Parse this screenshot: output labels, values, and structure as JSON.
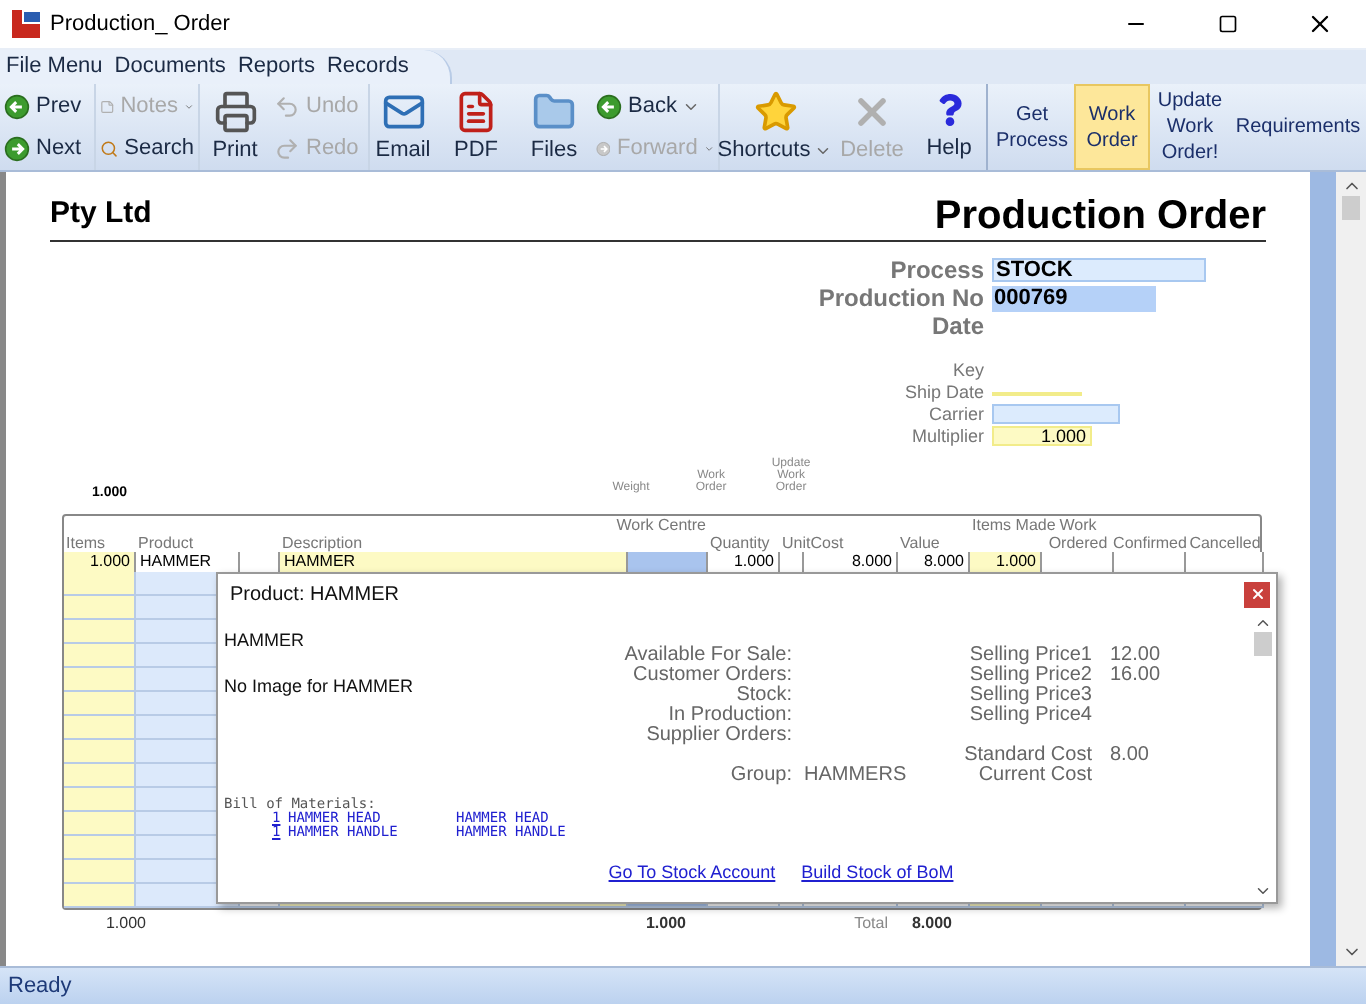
{
  "window": {
    "title": "Production_ Order"
  },
  "menu": [
    "File Menu",
    "Documents",
    "Reports",
    "Records"
  ],
  "toolbar": [
    {
      "kind": "pair",
      "top": {
        "label": "Prev",
        "disabled": false,
        "dropdown": false
      },
      "bottom": {
        "label": "Next",
        "disabled": false,
        "dropdown": false
      }
    },
    {
      "kind": "pair",
      "top": {
        "label": "Notes",
        "disabled": true,
        "dropdown": true
      },
      "bottom": {
        "label": "Search",
        "disabled": false,
        "dropdown": false
      }
    },
    {
      "kind": "large",
      "label": "Print",
      "disabled": false,
      "dropdown": false
    },
    {
      "kind": "pair",
      "top": {
        "label": "Undo",
        "disabled": true,
        "dropdown": false
      },
      "bottom": {
        "label": "Redo",
        "disabled": true,
        "dropdown": false
      }
    },
    {
      "kind": "large",
      "label": "Email",
      "disabled": false,
      "dropdown": false
    },
    {
      "kind": "large",
      "label": "PDF",
      "disabled": false,
      "dropdown": false
    },
    {
      "kind": "large",
      "label": "Files",
      "disabled": false,
      "dropdown": false
    },
    {
      "kind": "pair",
      "top": {
        "label": "Back",
        "disabled": false,
        "dropdown": true
      },
      "bottom": {
        "label": "Forward",
        "disabled": true,
        "dropdown": true
      }
    },
    {
      "kind": "large",
      "label": "Shortcuts",
      "disabled": false,
      "dropdown": true
    },
    {
      "kind": "large",
      "label": "Delete",
      "disabled": true,
      "dropdown": false
    },
    {
      "kind": "large",
      "label": "Help",
      "disabled": false,
      "dropdown": false
    },
    {
      "kind": "separator"
    },
    {
      "kind": "text",
      "label": "Get Process",
      "selected": false
    },
    {
      "kind": "text",
      "label": "Work Order",
      "selected": true
    },
    {
      "kind": "text",
      "label": "Update Work Order!",
      "selected": false
    },
    {
      "kind": "text",
      "label": "Requirements",
      "selected": false
    }
  ],
  "document": {
    "company": "Pty Ltd",
    "title": "Production Order",
    "fields": [
      {
        "label": "Process",
        "value": "STOCK",
        "kind": "lookup"
      },
      {
        "label": "Production No",
        "value": "000769",
        "kind": "highlighted"
      },
      {
        "label": "Date",
        "kind": "plain"
      },
      {
        "label": "Key",
        "kind": "small"
      },
      {
        "label": "Ship Date",
        "kind": "underline"
      },
      {
        "label": "Carrier",
        "kind": "small_lookup"
      },
      {
        "label": "Multiplier",
        "value": "1.000",
        "kind": "number"
      }
    ],
    "header_total": "1.000",
    "small_labels": [
      "Weight",
      "Work Order",
      "Update Work Order"
    ],
    "table": {
      "columns": [
        {
          "label": "Items",
          "kind": "column"
        },
        {
          "label": "Product",
          "kind": "column"
        },
        {
          "kind": "spacer"
        },
        {
          "label": "Description",
          "kind": "column"
        },
        {
          "label": "Work Centre",
          "kind": "column"
        },
        {
          "label": "Quantity",
          "kind": "column"
        },
        {
          "label": "UnitCost",
          "kind": "wide"
        },
        {
          "label": "Value",
          "kind": "column"
        },
        {
          "label": "Items Made",
          "kind": "column"
        },
        {
          "label": "Work Ordered",
          "kind": "column"
        },
        {
          "label": "Confirmed",
          "kind": "column"
        },
        {
          "label": "Cancelled",
          "kind": "column"
        }
      ],
      "rows": [
        {
          "items": "1.000",
          "product": "HAMMER",
          "description": "HAMMER",
          "quantity": "1.000",
          "unit_cost": "8.000",
          "value": "8.000",
          "items_made": "1.000"
        }
      ],
      "totals": {
        "items": "1.000",
        "work_centre": "1.000",
        "total_label": "Total",
        "value": "8.000"
      }
    }
  },
  "popup": {
    "title": "Product: HAMMER",
    "name": "HAMMER",
    "image_note": "No Image for HAMMER",
    "stats": [
      "Available For Sale:",
      "Customer Orders:",
      "Stock:",
      "In Production:",
      "Supplier Orders:"
    ],
    "group": {
      "label": "Group:",
      "value": "HAMMERS"
    },
    "selling_prices": [
      {
        "label": "Selling Price1",
        "value": "12.00"
      },
      {
        "label": "Selling Price2",
        "value": "16.00"
      },
      {
        "label": "Selling Price3"
      },
      {
        "label": "Selling Price4"
      }
    ],
    "costs": [
      {
        "label": "Standard Cost",
        "value": "8.00"
      },
      {
        "label": "Current Cost"
      }
    ],
    "bom": {
      "heading": "Bill of Materials:",
      "lines": [
        {
          "qty": "1",
          "code": "HAMMER HEAD",
          "description": "HAMMER HEAD"
        },
        {
          "qty": "1",
          "code": "HAMMER HANDLE",
          "description": "HAMMER HANDLE"
        }
      ]
    },
    "links": [
      "Go To Stock Account",
      "Build Stock of BoM"
    ]
  },
  "status_bar": "Ready"
}
